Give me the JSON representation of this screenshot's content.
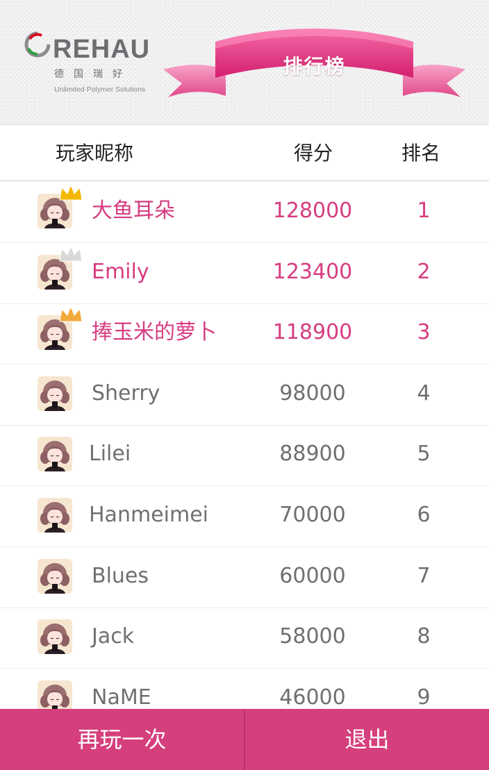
{
  "brand": {
    "name": "REHAU",
    "cn": "德国瑞好",
    "tagline": "Unlimited Polymer Solutions"
  },
  "header": {
    "title": "排行榜"
  },
  "table": {
    "columns": {
      "name": "玩家昵称",
      "score": "得分",
      "rank": "排名"
    },
    "rows": [
      {
        "name": "大鱼耳朵",
        "score": "128000",
        "rank": "1",
        "crown": "gold"
      },
      {
        "name": "Emily",
        "score": "123400",
        "rank": "2",
        "crown": "silver"
      },
      {
        "name": "捧玉米的萝卜",
        "score": "118900",
        "rank": "3",
        "crown": "bronze"
      },
      {
        "name": "Sherry",
        "score": "98000",
        "rank": "4"
      },
      {
        "name": "Lilei",
        "score": "88900",
        "rank": "5"
      },
      {
        "name": "Hanmeimei",
        "score": "70000",
        "rank": "6"
      },
      {
        "name": "Blues",
        "score": "60000",
        "rank": "7"
      },
      {
        "name": "Jack",
        "score": "58000",
        "rank": "8"
      },
      {
        "name": "NaME",
        "score": "46000",
        "rank": "9"
      }
    ]
  },
  "footer": {
    "replay_label": "再玩一次",
    "exit_label": "退出"
  },
  "colors": {
    "accent": "#d53f7d",
    "highlight_text": "#d63c80",
    "normal_text": "#6f6f6f",
    "crown_gold": "#f5b800",
    "crown_silver": "#d9d9d9",
    "crown_bronze": "#f2a93b"
  },
  "icons": {
    "avatar": "girl-avatar-icon",
    "crown": "crown-icon",
    "logo": "rehau-logo-icon"
  }
}
